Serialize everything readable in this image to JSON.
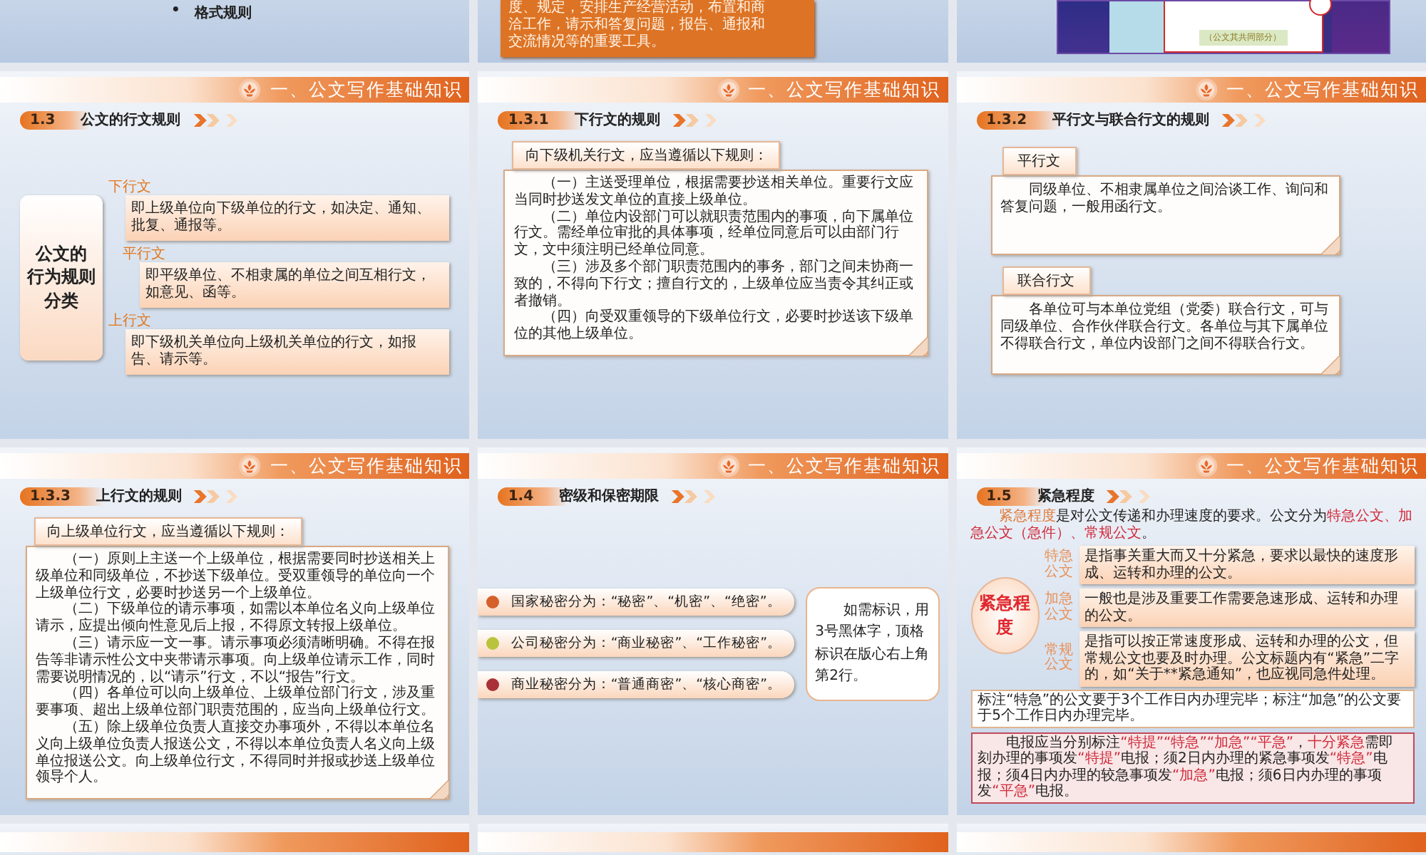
{
  "top_row": [
    {
      "kind": "bullets",
      "bullet": "•",
      "items": [
        "格式规则"
      ]
    },
    {
      "kind": "note",
      "lines": [
        "度、规定，安排生产经营活动，布置和商",
        "洽工作，请示和答复问题，报告、通报和",
        "交流情况等的重要工具。"
      ]
    },
    {
      "kind": "document",
      "caption": "（公文其共同部分）"
    }
  ],
  "slides": [
    {
      "kind": "classify",
      "section": "一、公文写作基础知识",
      "number": "1.3",
      "title": "公文的行文规则",
      "center": [
        "公文的",
        "行为规则",
        "分类"
      ],
      "items": [
        {
          "label": "下行文",
          "text": "即上级单位向下级单位的行文，如决定、通知、批复、通报等。"
        },
        {
          "label": "平行文",
          "text": "即平级单位、不相隶属的单位之间互相行文，如意见、函等。"
        },
        {
          "label": "上行文",
          "text": "即下级机关单位向上级机关单位的行文，如报告、请示等。"
        }
      ]
    },
    {
      "kind": "rules",
      "section": "一、公文写作基础知识",
      "number": "1.3.1",
      "title": "下行文的规则",
      "intro": "向下级机关行文，应当遵循以下规则：",
      "paragraphs": [
        "（一）主送受理单位，根据需要抄送相关单位。重要行文应当同时抄送发文单位的直接上级单位。",
        "（二）单位内设部门可以就职责范围内的事项，向下属单位行文。需经单位审批的具体事项，经单位同意后可以由部门行文，文中须注明已经单位同意。",
        "（三）涉及多个部门职责范围内的事务，部门之间未协商一致的，不得向下行文；擅自行文的，上级单位应当责令其纠正或者撤销。",
        "（四）向受双重领导的下级单位行文，必要时抄送该下级单位的其他上级单位。"
      ]
    },
    {
      "kind": "notes",
      "section": "一、公文写作基础知识",
      "number": "1.3.2",
      "title": "平行文与联合行文的规则",
      "notes": [
        {
          "label": "平行文",
          "text": "同级单位、不相隶属单位之间洽谈工作、询问和答复问题，一般用函行文。"
        },
        {
          "label": "联合行文",
          "text": "各单位可与本单位党组（党委）联合行文，可与同级单位、合作伙伴联合行文。各单位与其下属单位不得联合行文，单位内设部门之间不得联合行文。"
        }
      ]
    },
    {
      "kind": "rules",
      "section": "一、公文写作基础知识",
      "number": "1.3.3",
      "title": "上行文的规则",
      "intro": "向上级单位行文，应当遵循以下规则：",
      "paragraphs": [
        "（一）原则上主送一个上级单位，根据需要同时抄送相关上级单位和同级单位，不抄送下级单位。受双重领导的单位向一个上级单位行文，必要时抄送另一个上级单位。",
        "（二）下级单位的请示事项，如需以本单位名义向上级单位请示，应提出倾向性意见后上报，不得原文转报上级单位。",
        "（三）请示应一文一事。请示事项必须清晰明确。不得在报告等非请示性公文中夹带请示事项。向上级单位请示工作，同时需要说明情况的，以“请示”行文，不以“报告”行文。",
        "（四）各单位可以向上级单位、上级单位部门行文，涉及重要事项、超出上级单位部门职责范围的，应当向上级单位行文。",
        "（五）除上级单位负责人直接交办事项外，不得以本单位名义向上级单位负责人报送公文，不得以本单位负责人名义向上级单位报送公文。向上级单位行文，不得同时并报或抄送上级单位领导个人。"
      ]
    },
    {
      "kind": "secrecy",
      "section": "一、公文写作基础知识",
      "number": "1.4",
      "title": "密级和保密期限",
      "items": [
        {
          "text": "国家秘密分为：“秘密”、“机密”、“绝密”。",
          "color": "#d5602a"
        },
        {
          "text": "公司秘密分为：“商业秘密”、“工作秘密”。",
          "color": "#b9c43c"
        },
        {
          "text": "商业秘密分为：“普通商密”、“核心商密”。",
          "color": "#a83238"
        }
      ],
      "side_note": "如需标识，用3号黑体字，顶格标识在版心右上角第2行。"
    },
    {
      "kind": "urgency",
      "section": "一、公文写作基础知识",
      "number": "1.5",
      "title": "紧急程度",
      "intro": [
        {
          "text": "紧急程度",
          "color": "#e07a3a"
        },
        {
          "text": "是对公文传递和办理速度的要求。公文分为"
        },
        {
          "text": "特急公文、加急公文（急件）、常规公文",
          "color": "#d02a3a"
        },
        {
          "text": "。"
        }
      ],
      "circle": "紧急程度",
      "items": [
        {
          "label": "特急公文",
          "text": "是指事关重大而又十分紧急，要求以最快的速度形成、运转和办理的公文。"
        },
        {
          "label": "加急公文",
          "text": "一般也是涉及重要工作需要急速形成、运转和办理的公文。"
        },
        {
          "label": "常规公文",
          "text": "是指可以按正常速度形成、运转和办理的公文，但常规公文也要及时办理。公文标题内有“紧急”二字的，如“关于**紧急通知”，也应视同急件处理。"
        }
      ],
      "deadline_note": "标注“特急”的公文要于3个工作日内办理完毕；标注“加急”的公文要于5个工作日内办理完毕。",
      "telegram": [
        {
          "text": "电报应当分别标注"
        },
        {
          "text": "“特提”“特急”“加急”“平急”",
          "color": "#d02a3a"
        },
        {
          "text": "，"
        },
        {
          "text": "十分紧急",
          "color": "#d02a3a"
        },
        {
          "text": "需即刻办理的事项发"
        },
        {
          "text": "“特提”",
          "color": "#d02a3a"
        },
        {
          "text": "电报；须2日内办理的紧急事项发"
        },
        {
          "text": "“特急”",
          "color": "#d02a3a"
        },
        {
          "text": "电报；须4日内办理的较急事项发"
        },
        {
          "text": "“加急”",
          "color": "#d02a3a"
        },
        {
          "text": "电报；须6日内办理的事项发"
        },
        {
          "text": "“平急”",
          "color": "#d02a3a"
        },
        {
          "text": "电报。"
        }
      ]
    }
  ],
  "bottom_row": [
    {
      "kind": "blank"
    },
    {
      "kind": "blank"
    },
    {
      "kind": "blank"
    }
  ]
}
